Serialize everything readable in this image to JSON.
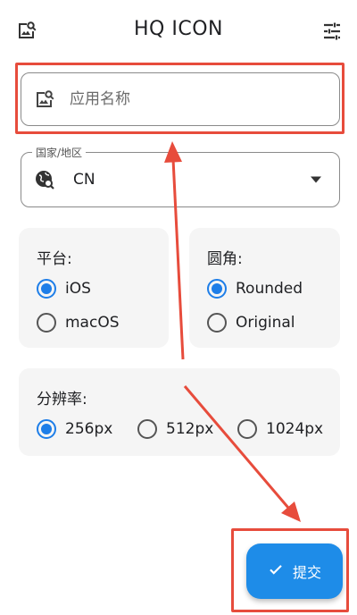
{
  "header": {
    "title": "HQ ICON"
  },
  "app_name_field": {
    "placeholder": "应用名称",
    "value": ""
  },
  "country_field": {
    "legend": "国家/地区",
    "value": "CN"
  },
  "platform": {
    "title": "平台:",
    "options": [
      {
        "label": "iOS",
        "selected": true
      },
      {
        "label": "macOS",
        "selected": false
      }
    ]
  },
  "corner": {
    "title": "圆角:",
    "options": [
      {
        "label": "Rounded",
        "selected": true
      },
      {
        "label": "Original",
        "selected": false
      }
    ]
  },
  "resolution": {
    "title": "分辨率:",
    "options": [
      {
        "label": "256px",
        "selected": true
      },
      {
        "label": "512px",
        "selected": false
      },
      {
        "label": "1024px",
        "selected": false
      }
    ]
  },
  "submit": {
    "label": "提交"
  },
  "colors": {
    "accent": "#1e8ce8",
    "radio_selected": "#1e7ee8",
    "annotation_red": "#e74c3c",
    "card_bg": "#f5f5f5"
  },
  "icons": {
    "top_left": "image-search-icon",
    "top_right": "tune-settings-icon",
    "app_field": "image-search-icon",
    "country_field": "globe-search-icon",
    "submit": "check-icon"
  }
}
